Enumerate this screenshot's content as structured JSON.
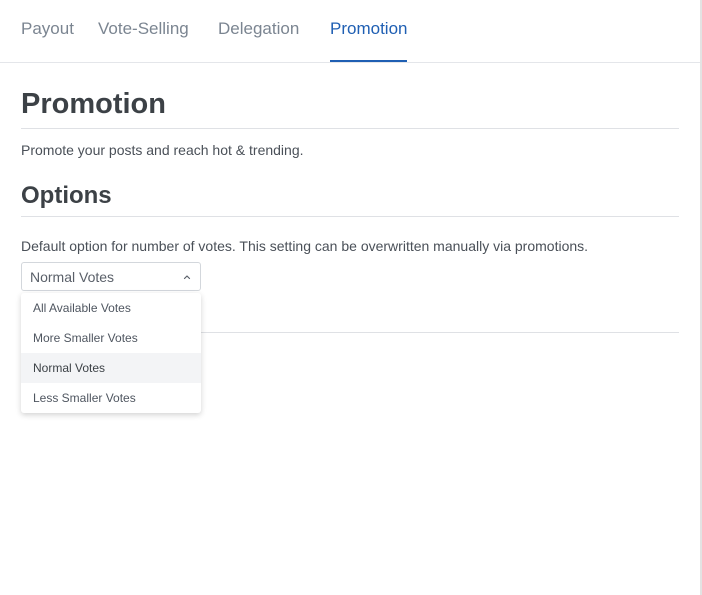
{
  "tabs": [
    {
      "label": "Payout"
    },
    {
      "label": "Vote-Selling"
    },
    {
      "label": "Delegation"
    },
    {
      "label": "Promotion"
    }
  ],
  "page": {
    "title": "Promotion",
    "subtitle": "Promote your posts and reach hot & trending."
  },
  "options": {
    "title": "Options",
    "description": "Default option for number of votes. This setting can be overwritten manually via promotions.",
    "select_value": "Normal Votes",
    "dropdown_items": [
      {
        "label": "All Available Votes"
      },
      {
        "label": "More Smaller Votes"
      },
      {
        "label": "Normal Votes"
      },
      {
        "label": "Less Smaller Votes"
      }
    ]
  },
  "colors": {
    "accent": "#1f5fb3",
    "tab_inactive": "#7b8591",
    "heading": "#3c4146"
  },
  "icons": {
    "select_indicator": "chevron-up-icon"
  }
}
